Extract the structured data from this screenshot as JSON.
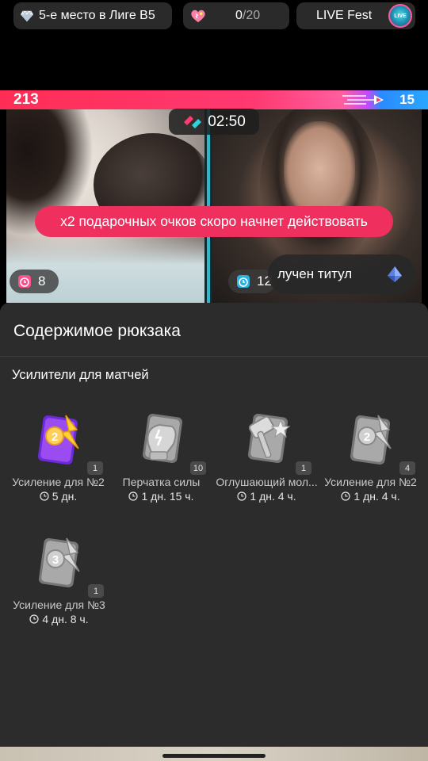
{
  "top": {
    "league_label": "5-е место в Лиге B5",
    "hearts_current": "0",
    "hearts_total": "/20",
    "fest_label": "LIVE Fest",
    "fest_badge": "LIVE"
  },
  "battle": {
    "score_left": "213",
    "score_right": "15",
    "timer": "02:50",
    "banner": "x2 подарочных очков скоро начнет действовать",
    "viewers_left": "8",
    "viewers_right": "12",
    "toast": "лучен титул"
  },
  "backpack": {
    "title": "Содержимое рюкзака",
    "section": "Усилители для матчей",
    "items": [
      {
        "name": "Усиление для №2",
        "qty": "1",
        "time": "5 дн.",
        "icon": "boost-2-card-icon"
      },
      {
        "name": "Перчатка силы",
        "qty": "10",
        "time": "1 дн. 15 ч.",
        "icon": "power-glove-card-icon"
      },
      {
        "name": "Оглушающий мол...",
        "qty": "1",
        "time": "1 дн. 4 ч.",
        "icon": "stun-hammer-card-icon"
      },
      {
        "name": "Усиление для №2",
        "qty": "4",
        "time": "1 дн. 4 ч.",
        "icon": "boost-2-card-icon"
      },
      {
        "name": "Усиление для №3",
        "qty": "1",
        "time": "4 дн. 8 ч.",
        "icon": "boost-3-card-icon"
      }
    ]
  },
  "colors": {
    "accent_pink": "#ff2d55",
    "accent_blue": "#2aa6ff",
    "sheet_bg": "#2c2c2c",
    "banner_bg": "#ef2f5e"
  }
}
